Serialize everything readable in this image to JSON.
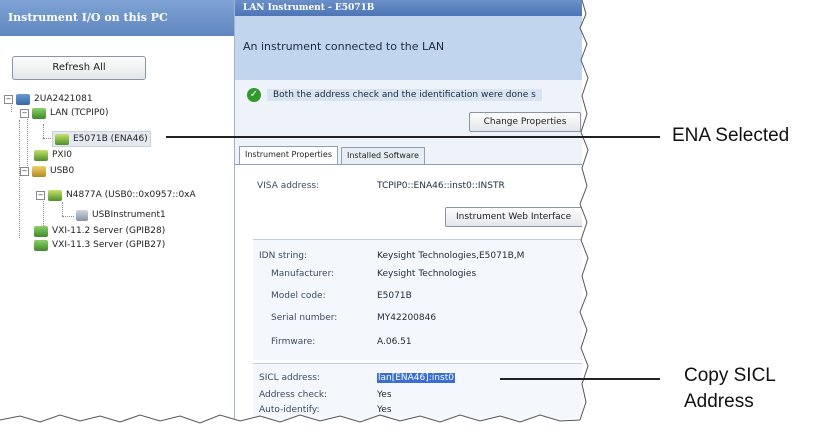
{
  "left_panel": {
    "title": "Instrument I/O on this PC",
    "refresh_label": "Refresh All",
    "tree": [
      {
        "label": "2UA2421081",
        "icon": "computer-icon"
      },
      {
        "label": "LAN (TCPIP0)",
        "icon": "network-icon"
      },
      {
        "label": "E5071B (ENA46)",
        "icon": "instrument-icon",
        "selected": true
      },
      {
        "label": "PXI0",
        "icon": "pxi-icon"
      },
      {
        "label": "USB0",
        "icon": "usb-icon"
      },
      {
        "label": "N4877A (USB0::0x0957::0xA",
        "icon": "instrument-icon"
      },
      {
        "label": "USBInstrument1",
        "icon": "usb-device-icon"
      },
      {
        "label": "VXI-11.2 Server (GPIB28)",
        "icon": "network-icon"
      },
      {
        "label": "VXI-11.3 Server (GPIB27)",
        "icon": "network-icon"
      }
    ]
  },
  "right_panel": {
    "title": "LAN Instrument - E5071B",
    "description": "An instrument connected to the LAN",
    "status_text": "Both the address check and the identification were done s",
    "change_properties_label": "Change Properties",
    "tabs": [
      {
        "label": "Instrument Properties",
        "active": true
      },
      {
        "label": "Installed Software",
        "active": false
      }
    ],
    "visa_label": "VISA address:",
    "visa_value": "TCPIP0::ENA46::inst0::INSTR",
    "web_button_label": "Instrument Web Interface",
    "idn_label": "IDN string:",
    "idn_value": "Keysight Technologies,E5071B,M",
    "manufacturer_label": "Manufacturer:",
    "manufacturer_value": "Keysight Technologies",
    "model_label": "Model code:",
    "model_value": "E5071B",
    "serial_label": "Serial number:",
    "serial_value": "MY42200846",
    "firmware_label": "Firmware:",
    "firmware_value": "A.06.51",
    "sicl_label": "SICL address:",
    "sicl_value": "lan[ENA46]:inst0",
    "address_check_label": "Address check:",
    "address_check_value": "Yes",
    "auto_identify_label": "Auto-identify:",
    "auto_identify_value": "Yes"
  },
  "callouts": {
    "ena_selected": "ENA Selected",
    "copy_sicl_line1": "Copy SICL",
    "copy_sicl_line2": "Address"
  },
  "colors": {
    "header_blue": "#5f86bf",
    "desc_bg": "#c2d5ee",
    "selection_blue": "#3a6fd0",
    "ok_green": "#2f9a2a"
  }
}
